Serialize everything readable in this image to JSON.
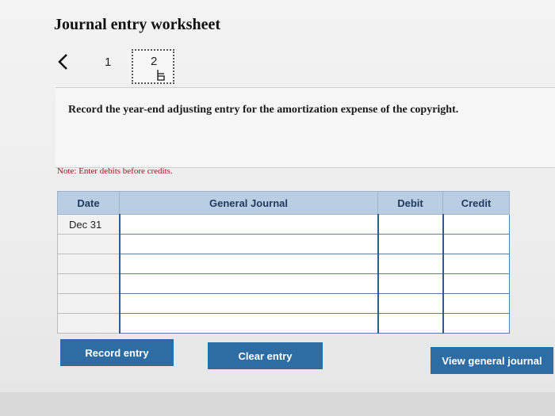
{
  "worksheet": {
    "title": "Journal entry worksheet",
    "pages": [
      "1",
      "2"
    ],
    "current_page": "2",
    "instruction": "Record the year-end adjusting entry for the amortization expense of the copyright.",
    "note": "Note: Enter debits before credits."
  },
  "journal": {
    "headers": {
      "date": "Date",
      "account": "General Journal",
      "debit": "Debit",
      "credit": "Credit"
    },
    "rows": [
      {
        "date": "Dec 31",
        "account": "",
        "debit": "",
        "credit": ""
      },
      {
        "date": "",
        "account": "",
        "debit": "",
        "credit": ""
      },
      {
        "date": "",
        "account": "",
        "debit": "",
        "credit": ""
      },
      {
        "date": "",
        "account": "",
        "debit": "",
        "credit": ""
      },
      {
        "date": "",
        "account": "",
        "debit": "",
        "credit": ""
      },
      {
        "date": "",
        "account": "",
        "debit": "",
        "credit": ""
      }
    ]
  },
  "buttons": {
    "record": "Record entry",
    "clear": "Clear entry",
    "view": "View general journal"
  },
  "colors": {
    "button": "#2d6da4",
    "header": "#b9cde3",
    "header_text": "#1e3a5f",
    "note": "#8b1a1a"
  }
}
